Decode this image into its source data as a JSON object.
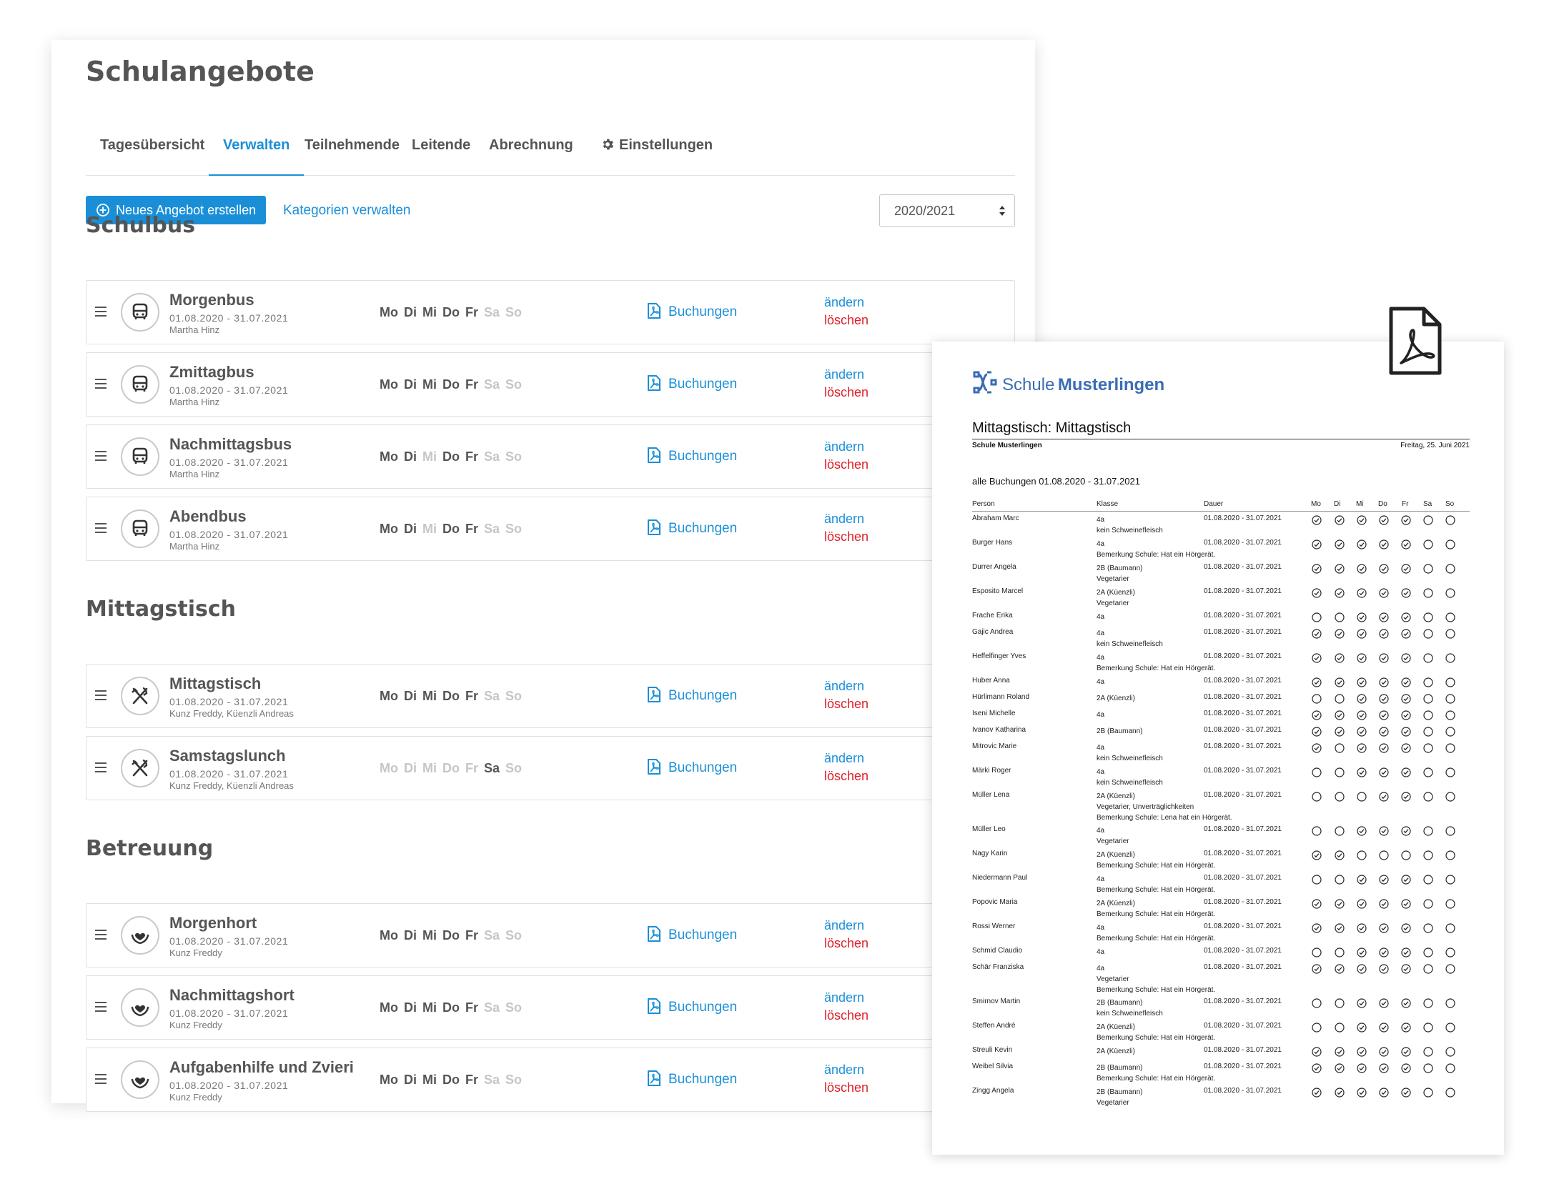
{
  "app": {
    "title": "Schulangebote",
    "tabs": [
      "Tagesübersicht",
      "Verwalten",
      "Teilnehmende",
      "Leitende",
      "Abrechnung",
      "Einstellungen"
    ],
    "active_tab": "Verwalten"
  },
  "toolbar": {
    "new_button": "Neues Angebot erstellen",
    "categories_link": "Kategorien verwalten",
    "year_select": "2020/2021"
  },
  "labels": {
    "bookings": "Buchungen",
    "edit": "ändern",
    "delete": "löschen",
    "days": [
      "Mo",
      "Di",
      "Mi",
      "Do",
      "Fr",
      "Sa",
      "So"
    ]
  },
  "sections": [
    {
      "title": "Schulbus",
      "icon": "bus-icon",
      "rows": [
        {
          "name": "Morgenbus",
          "dates": "01.08.2020 - 31.07.2021",
          "leader": "Martha Hinz",
          "days": [
            true,
            true,
            true,
            true,
            true,
            false,
            false
          ]
        },
        {
          "name": "Zmittagbus",
          "dates": "01.08.2020 - 31.07.2021",
          "leader": "Martha Hinz",
          "days": [
            true,
            true,
            true,
            true,
            true,
            false,
            false
          ]
        },
        {
          "name": "Nachmittagsbus",
          "dates": "01.08.2020 - 31.07.2021",
          "leader": "Martha Hinz",
          "days": [
            true,
            true,
            false,
            true,
            true,
            false,
            false
          ]
        },
        {
          "name": "Abendbus",
          "dates": "01.08.2020 - 31.07.2021",
          "leader": "Martha Hinz",
          "days": [
            true,
            true,
            false,
            true,
            true,
            false,
            false
          ]
        }
      ]
    },
    {
      "title": "Mittagstisch",
      "icon": "fork-knife-icon",
      "rows": [
        {
          "name": "Mittagstisch",
          "dates": "01.08.2020 - 31.07.2021",
          "leader": "Kunz Freddy, Küenzli Andreas",
          "days": [
            true,
            true,
            true,
            true,
            true,
            false,
            false
          ]
        },
        {
          "name": "Samstagslunch",
          "dates": "01.08.2020 - 31.07.2021",
          "leader": "Kunz Freddy, Küenzli Andreas",
          "days": [
            false,
            false,
            false,
            false,
            false,
            true,
            false
          ]
        }
      ]
    },
    {
      "title": "Betreuung",
      "icon": "heart-hands-icon",
      "rows": [
        {
          "name": "Morgenhort",
          "dates": "01.08.2020 - 31.07.2021",
          "leader": "Kunz Freddy",
          "days": [
            true,
            true,
            true,
            true,
            true,
            false,
            false
          ]
        },
        {
          "name": "Nachmittagshort",
          "dates": "01.08.2020 - 31.07.2021",
          "leader": "Kunz Freddy",
          "days": [
            true,
            true,
            true,
            true,
            true,
            false,
            false
          ]
        },
        {
          "name": "Aufgabenhilfe und Zvieri",
          "dates": "01.08.2020 - 31.07.2021",
          "leader": "Kunz Freddy",
          "days": [
            true,
            true,
            true,
            true,
            true,
            false,
            false
          ]
        }
      ]
    }
  ],
  "pdf": {
    "logo_part1": "Schule",
    "logo_part2": "Musterlingen",
    "title": "Mittagstisch: Mittagstisch",
    "school": "Schule Musterlingen",
    "date": "Freitag, 25. Juni 2021",
    "subtitle": "alle Buchungen 01.08.2020 - 31.07.2021",
    "headers": [
      "Person",
      "Klasse",
      "Dauer",
      "Mo",
      "Di",
      "Mi",
      "Do",
      "Fr",
      "Sa",
      "So"
    ],
    "rows": [
      {
        "person": "Abraham Marc",
        "klasse": "4a",
        "notes": [
          "kein Schweinefleisch"
        ],
        "dauer": "01.08.2020 - 31.07.2021",
        "days": [
          1,
          1,
          1,
          1,
          1,
          0,
          0
        ]
      },
      {
        "person": "Burger Hans",
        "klasse": "4a",
        "notes": [
          "Bemerkung Schule: Hat ein Hörgerät."
        ],
        "dauer": "01.08.2020 - 31.07.2021",
        "days": [
          1,
          1,
          1,
          1,
          1,
          0,
          0
        ]
      },
      {
        "person": "Durrer Angela",
        "klasse": "2B (Baumann)",
        "notes": [
          "Vegetarier"
        ],
        "dauer": "01.08.2020 - 31.07.2021",
        "days": [
          1,
          1,
          1,
          1,
          1,
          0,
          0
        ]
      },
      {
        "person": "Esposito Marcel",
        "klasse": "2A (Küenzli)",
        "notes": [
          "Vegetarier"
        ],
        "dauer": "01.08.2020 - 31.07.2021",
        "days": [
          1,
          1,
          1,
          1,
          1,
          0,
          0
        ]
      },
      {
        "person": "Frache Erika",
        "klasse": "4a",
        "notes": [],
        "dauer": "01.08.2020 - 31.07.2021",
        "days": [
          0,
          0,
          1,
          1,
          1,
          0,
          0
        ]
      },
      {
        "person": "Gajic Andrea",
        "klasse": "4a",
        "notes": [
          "kein Schweinefleisch"
        ],
        "dauer": "01.08.2020 - 31.07.2021",
        "days": [
          1,
          1,
          1,
          1,
          1,
          0,
          0
        ]
      },
      {
        "person": "Heffelfinger Yves",
        "klasse": "4a",
        "notes": [
          "Bemerkung Schule: Hat ein Hörgerät."
        ],
        "dauer": "01.08.2020 - 31.07.2021",
        "days": [
          1,
          1,
          1,
          1,
          1,
          0,
          0
        ]
      },
      {
        "person": "Huber Anna",
        "klasse": "4a",
        "notes": [],
        "dauer": "01.08.2020 - 31.07.2021",
        "days": [
          1,
          1,
          1,
          1,
          1,
          0,
          0
        ]
      },
      {
        "person": "Hürlimann Roland",
        "klasse": "2A (Küenzli)",
        "notes": [],
        "dauer": "01.08.2020 - 31.07.2021",
        "days": [
          0,
          0,
          1,
          1,
          1,
          0,
          0
        ]
      },
      {
        "person": "Iseni Michelle",
        "klasse": "4a",
        "notes": [],
        "dauer": "01.08.2020 - 31.07.2021",
        "days": [
          1,
          1,
          1,
          1,
          1,
          0,
          0
        ]
      },
      {
        "person": "Ivanov Katharina",
        "klasse": "2B (Baumann)",
        "notes": [],
        "dauer": "01.08.2020 - 31.07.2021",
        "days": [
          1,
          1,
          1,
          1,
          1,
          0,
          0
        ]
      },
      {
        "person": "Mitrovic Marie",
        "klasse": "4a",
        "notes": [
          "kein Schweinefleisch"
        ],
        "dauer": "01.08.2020 - 31.07.2021",
        "days": [
          1,
          0,
          1,
          1,
          1,
          0,
          0
        ]
      },
      {
        "person": "Märki Roger",
        "klasse": "4a",
        "notes": [
          "kein Schweinefleisch"
        ],
        "dauer": "01.08.2020 - 31.07.2021",
        "days": [
          0,
          0,
          1,
          1,
          1,
          0,
          0
        ]
      },
      {
        "person": "Müller Lena",
        "klasse": "2A (Küenzli)",
        "notes": [
          "Vegetarier, Unverträglichkeiten",
          "Bemerkung Schule: Lena hat ein Hörgerät."
        ],
        "dauer": "01.08.2020 - 31.07.2021",
        "days": [
          0,
          0,
          0,
          1,
          1,
          0,
          0
        ]
      },
      {
        "person": "Müller Leo",
        "klasse": "4a",
        "notes": [
          "Vegetarier"
        ],
        "dauer": "01.08.2020 - 31.07.2021",
        "days": [
          0,
          0,
          1,
          1,
          1,
          0,
          0
        ]
      },
      {
        "person": "Nagy Karin",
        "klasse": "2A (Küenzli)",
        "notes": [
          "Bemerkung Schule: Hat ein Hörgerät."
        ],
        "dauer": "01.08.2020 - 31.07.2021",
        "days": [
          1,
          1,
          0,
          0,
          0,
          0,
          0
        ]
      },
      {
        "person": "Niedermann Paul",
        "klasse": "4a",
        "notes": [
          "Bemerkung Schule: Hat ein Hörgerät."
        ],
        "dauer": "01.08.2020 - 31.07.2021",
        "days": [
          0,
          0,
          1,
          1,
          1,
          0,
          0
        ]
      },
      {
        "person": "Popovic Maria",
        "klasse": "2A (Küenzli)",
        "notes": [
          "Bemerkung Schule: Hat ein Hörgerät."
        ],
        "dauer": "01.08.2020 - 31.07.2021",
        "days": [
          1,
          1,
          1,
          1,
          1,
          0,
          0
        ]
      },
      {
        "person": "Rossi Werner",
        "klasse": "4a",
        "notes": [
          "Bemerkung Schule: Hat ein Hörgerät."
        ],
        "dauer": "01.08.2020 - 31.07.2021",
        "days": [
          1,
          1,
          1,
          1,
          1,
          0,
          0
        ]
      },
      {
        "person": "Schmid Claudio",
        "klasse": "4a",
        "notes": [],
        "dauer": "01.08.2020 - 31.07.2021",
        "days": [
          0,
          0,
          1,
          1,
          1,
          0,
          0
        ]
      },
      {
        "person": "Schär Franziska",
        "klasse": "4a",
        "notes": [
          "Vegetarier",
          "Bemerkung Schule: Hat ein Hörgerät."
        ],
        "dauer": "01.08.2020 - 31.07.2021",
        "days": [
          1,
          1,
          1,
          1,
          1,
          0,
          0
        ]
      },
      {
        "person": "Smirnov Martin",
        "klasse": "2B (Baumann)",
        "notes": [
          "kein Schweinefleisch"
        ],
        "dauer": "01.08.2020 - 31.07.2021",
        "days": [
          0,
          0,
          1,
          1,
          1,
          0,
          0
        ]
      },
      {
        "person": "Steffen André",
        "klasse": "2A (Küenzli)",
        "notes": [
          "Bemerkung Schule: Hat ein Hörgerät."
        ],
        "dauer": "01.08.2020 - 31.07.2021",
        "days": [
          0,
          0,
          1,
          1,
          1,
          0,
          0
        ]
      },
      {
        "person": "Streuli Kevin",
        "klasse": "2A (Küenzli)",
        "notes": [],
        "dauer": "01.08.2020 - 31.07.2021",
        "days": [
          1,
          1,
          1,
          1,
          1,
          0,
          0
        ]
      },
      {
        "person": "Weibel Silvia",
        "klasse": "2B (Baumann)",
        "notes": [
          "Bemerkung Schule: Hat ein Hörgerät."
        ],
        "dauer": "01.08.2020 - 31.07.2021",
        "days": [
          1,
          1,
          1,
          1,
          1,
          0,
          0
        ]
      },
      {
        "person": "Zingg Angela",
        "klasse": "2B (Baumann)",
        "notes": [
          "Vegetarier"
        ],
        "dauer": "01.08.2020 - 31.07.2021",
        "days": [
          1,
          1,
          1,
          1,
          1,
          0,
          0
        ]
      }
    ]
  }
}
